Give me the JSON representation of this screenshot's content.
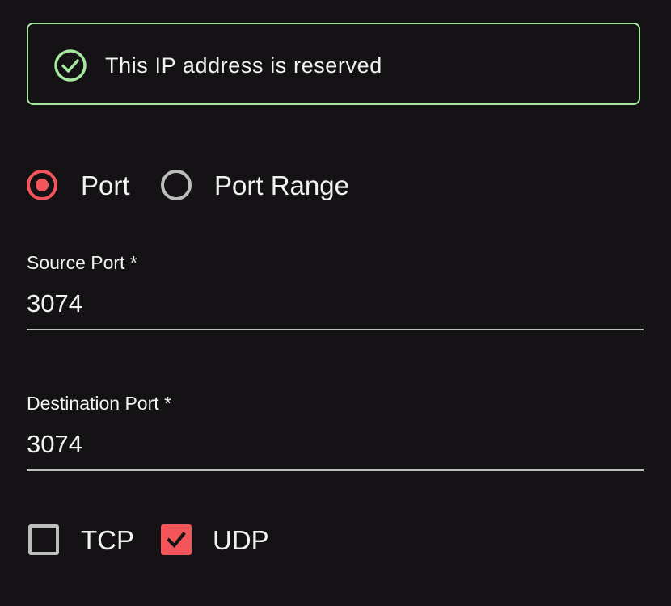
{
  "alert": {
    "icon": "check-circle-icon",
    "text": "This IP address is reserved",
    "color": "#a6e8a0"
  },
  "port_type": {
    "options": [
      {
        "label": "Port",
        "selected": true
      },
      {
        "label": "Port Range",
        "selected": false
      }
    ]
  },
  "source_port": {
    "label": "Source Port *",
    "value": "3074"
  },
  "destination_port": {
    "label": "Destination Port *",
    "value": "3074"
  },
  "protocols": {
    "options": [
      {
        "label": "TCP",
        "checked": false
      },
      {
        "label": "UDP",
        "checked": true
      }
    ]
  },
  "colors": {
    "accent": "#f2555a",
    "background": "#141214",
    "success": "#a6e8a0"
  }
}
